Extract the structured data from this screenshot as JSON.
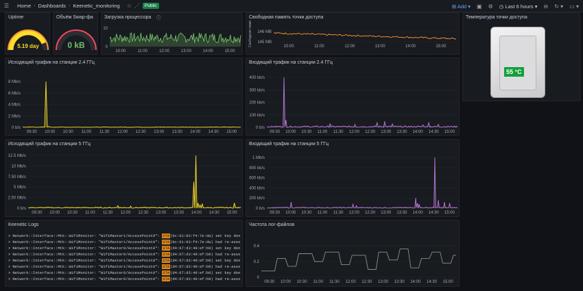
{
  "topbar": {
    "menu_icon": "hamburger-icon",
    "breadcrumb": [
      "Home",
      "Dashboards",
      "Keenetic_monitoring"
    ],
    "public_badge": "Public",
    "add_label": "Add",
    "time_range": "Last 6 hours"
  },
  "time_ticks_1": [
    "09:30",
    "10:00",
    "10:30",
    "11:00",
    "11:30",
    "12:00",
    "12:30",
    "13:00",
    "13:30",
    "14:00",
    "14:30",
    "15:00"
  ],
  "time_ticks_2": [
    "10:00",
    "11:00",
    "12:00",
    "13:00",
    "14:00",
    "15:00"
  ],
  "panels": {
    "uptime": {
      "title": "Uptime",
      "value": "5.19 day"
    },
    "swap": {
      "title": "Объём Swap-фа",
      "value": "0 kB"
    },
    "cpu": {
      "title": "Загрузка процессора",
      "y_ticks": [
        "10",
        "0"
      ]
    },
    "mem": {
      "title": "Свободная память точки доступа",
      "y_label": "Свободная памя",
      "y_ticks": [
        "145 MB",
        "146 MB"
      ]
    },
    "temp": {
      "title": "Температура точки доступа",
      "value": "55 °C"
    },
    "out24": {
      "title": "Исходящий трафик на станции 2.4 ГГц",
      "y_ticks": [
        "8 Mb/s",
        "6 Mb/s",
        "4 Mb/s",
        "2 Mb/s",
        "0 b/s"
      ]
    },
    "in24": {
      "title": "Входящий трафик на станции 2.4 ГГц",
      "y_ticks": [
        "400 kb/s",
        "300 kb/s",
        "200 kb/s",
        "100 kb/s",
        "0 b/s"
      ]
    },
    "out5": {
      "title": "Исходящий трафик на станции 5 ГГц",
      "y_ticks": [
        "12.5 Mb/s",
        "10 Mb/s",
        "7.50 Mb/s",
        "5 Mb/s",
        "2.50 Mb/s",
        "0 b/s"
      ]
    },
    "in5": {
      "title": "Входящий трафик на станции 5 ГГц",
      "y_ticks": [
        "1 Mb/s",
        "800 kb/s",
        "600 kb/s",
        "400 kb/s",
        "200 kb/s",
        "0 b/s"
      ]
    },
    "logs": {
      "title": "Keenetic Logs"
    },
    "freq": {
      "title": "Частота лог-файлов",
      "y_ticks": [
        "0.4",
        "0.2",
        "0"
      ]
    }
  },
  "logs": [
    {
      "pre": "Network::Interface::Mtk::WifiMonitor: \"WifiMaster1/AccessPoint0\": ",
      "sta": "STA",
      "post": "(bc:61:93:f4:7e:da) set key don"
    },
    {
      "pre": "Network::Interface::Mtk::WifiMonitor: \"WifiMaster1/AccessPoint0\": ",
      "sta": "STA",
      "post": "(bc:61:93:f4:7e:da) had re-asso"
    },
    {
      "pre": "Network::Interface::Mtk::WifiMonitor: \"WifiMaster0/AccessPoint0\": ",
      "sta": "STA",
      "post": "(d4:67:d3:49:ef:b9) set key don"
    },
    {
      "pre": "Network::Interface::Mtk::WifiMonitor: \"WifiMaster0/AccessPoint0\": ",
      "sta": "STA",
      "post": "(d4:67:d3:49:ef:b9) had re-asso"
    },
    {
      "pre": "Network::Interface::Mtk::WifiMonitor: \"WifiMaster1/AccessPoint0\": ",
      "sta": "STA",
      "post": "(d4:67:d3:49:ef:b9) set key don"
    },
    {
      "pre": "Network::Interface::Mtk::WifiMonitor: \"WifiMaster1/AccessPoint0\": ",
      "sta": "STA",
      "post": "(d4:67:d3:49:ef:b9) had re-asso"
    },
    {
      "pre": "Network::Interface::Mtk::WifiMonitor: \"WifiMaster0/AccessPoint0\": ",
      "sta": "STA",
      "post": "(d4:67:d3:49:ef:b9) set key don"
    },
    {
      "pre": "Network::Interface::Mtk::WifiMonitor: \"WifiMaster0/AccessPoint0\": ",
      "sta": "STA",
      "post": "(d4:67:d3:49:ef:b9) had re-asso"
    }
  ],
  "colors": {
    "green": "#73bf69",
    "yellow": "#fade2a",
    "orange": "#ff9830",
    "purple": "#b877d9",
    "red": "#f2495c",
    "grey": "#8e8e8e"
  }
}
